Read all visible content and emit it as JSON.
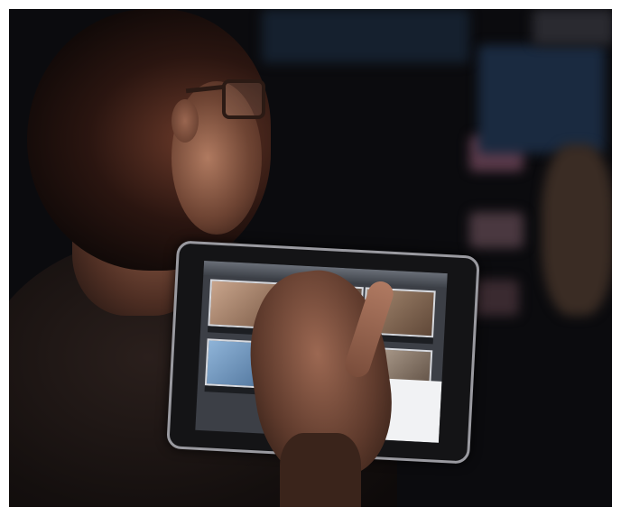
{
  "photo": {
    "description": "",
    "scene_colors": {
      "background": "#0b0b0e",
      "tablet_frame": "#9a9aa0",
      "skin": "#9c6852",
      "screen": "#3c3f46",
      "accent_logo": "#1fb6e8"
    }
  }
}
